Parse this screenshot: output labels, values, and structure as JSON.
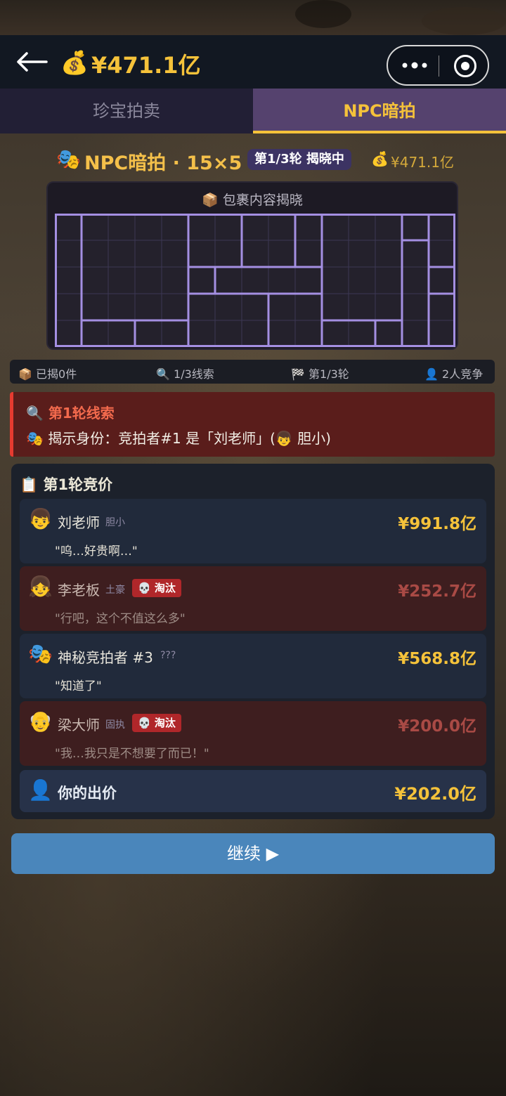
{
  "header": {
    "back_icon": "arrow-left-icon",
    "money_bag_icon": "💰",
    "balance": "¥471.1亿",
    "more_icon": "more-dots-icon",
    "record_icon": "record-icon"
  },
  "tabs": [
    {
      "label": "珍宝拍卖",
      "active": false
    },
    {
      "label": "NPC暗拍",
      "active": true
    }
  ],
  "title": {
    "mask_icon": "🎭",
    "text": "NPC暗拍 · 15×5",
    "round_badge": "第1/3轮 揭晓中",
    "bag_icon": "💰",
    "balance": "¥471.1亿"
  },
  "grid_panel": {
    "box_icon": "📦",
    "caption": "包裹内容揭晓",
    "cols": 15,
    "rows": 5
  },
  "stats": [
    {
      "icon": "📦",
      "text": "已揭0件"
    },
    {
      "icon": "🔍",
      "text": "1/3线索"
    },
    {
      "icon": "🏁",
      "text": "第1/3轮"
    },
    {
      "icon": "👤",
      "text": "2人竞争"
    }
  ],
  "clue": {
    "icon": "🔍",
    "heading": "第1轮线索",
    "mask_icon": "🎭",
    "body_prefix": "揭示身份：竞拍者#1 是「刘老师」(",
    "face_icon": "👦",
    "body_suffix": " 胆小)"
  },
  "bids": {
    "icon": "📋",
    "heading": "第1轮竞价",
    "rows": [
      {
        "avatar": "👦",
        "name": "刘老师",
        "tag": "胆小",
        "eliminated": false,
        "elim_label": "",
        "quote": "\"呜…好贵啊…\"",
        "price": "¥991.8亿"
      },
      {
        "avatar": "👧",
        "name": "李老板",
        "tag": "土豪",
        "eliminated": true,
        "elim_label": "💀 淘汰",
        "quote": "\"行吧，这个不值这么多\"",
        "price": "¥252.7亿"
      },
      {
        "avatar": "🎭",
        "name": "神秘竞拍者 #3",
        "tag": "???",
        "eliminated": false,
        "elim_label": "",
        "quote": "\"知道了\"",
        "price": "¥568.8亿"
      },
      {
        "avatar": "👴",
        "name": "梁大师",
        "tag": "固执",
        "eliminated": true,
        "elim_label": "💀 淘汰",
        "quote": "\"我…我只是不想要了而已！\"",
        "price": "¥200.0亿"
      }
    ],
    "my_bid": {
      "icon": "👤",
      "label": "你的出价",
      "price": "¥202.0亿"
    }
  },
  "continue_button": {
    "label": "继续 ▶"
  }
}
